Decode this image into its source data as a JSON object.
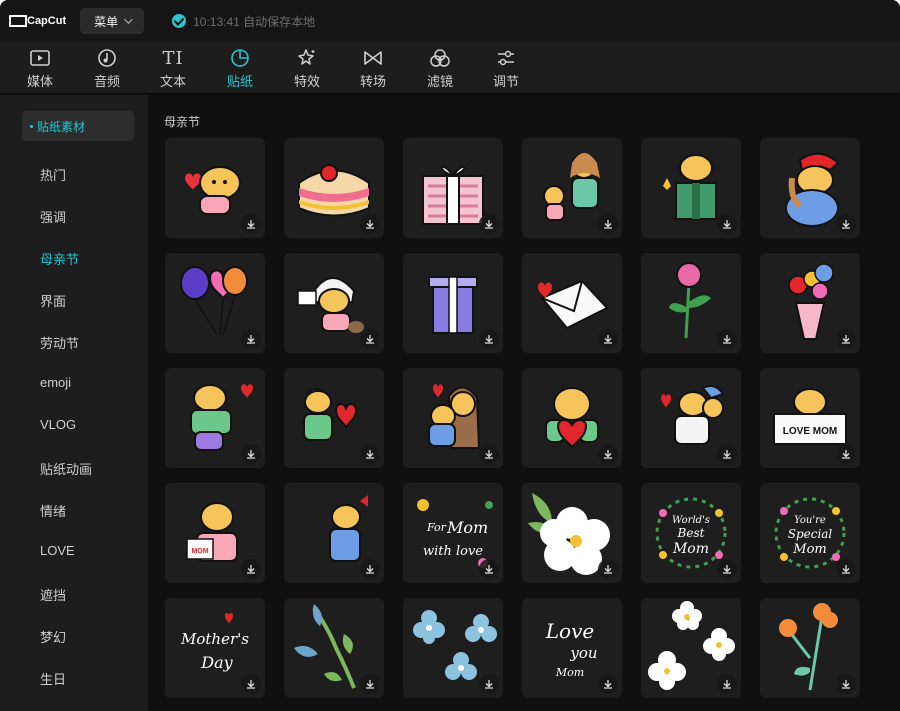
{
  "app": {
    "logo_text": "CapCut",
    "menu_label": "菜单",
    "save_status": "10:13:41 自动保存本地"
  },
  "toolbar": {
    "items": [
      {
        "label": "媒体",
        "icon": "media-icon",
        "active": false
      },
      {
        "label": "音频",
        "icon": "audio-icon",
        "active": false
      },
      {
        "label": "文本",
        "icon": "text-icon",
        "active": false
      },
      {
        "label": "贴纸",
        "icon": "sticker-icon",
        "active": true
      },
      {
        "label": "特效",
        "icon": "effects-icon",
        "active": false
      },
      {
        "label": "转场",
        "icon": "transition-icon",
        "active": false
      },
      {
        "label": "滤镜",
        "icon": "filter-icon",
        "active": false
      },
      {
        "label": "调节",
        "icon": "adjust-icon",
        "active": false
      }
    ],
    "text_icon_glyph": "TI"
  },
  "sidebar": {
    "header": "贴纸素材",
    "items": [
      {
        "label": "热门"
      },
      {
        "label": "强调"
      },
      {
        "label": "母亲节",
        "active": true
      },
      {
        "label": "界面"
      },
      {
        "label": "劳动节"
      },
      {
        "label": "emoji"
      },
      {
        "label": "VLOG"
      },
      {
        "label": "贴纸动画"
      },
      {
        "label": "情绪"
      },
      {
        "label": "LOVE"
      },
      {
        "label": "遮挡"
      },
      {
        "label": "梦幻"
      },
      {
        "label": "生日"
      }
    ]
  },
  "content": {
    "section_title": "母亲节",
    "stickers": [
      {
        "name": "cartoon-heart-character"
      },
      {
        "name": "cake"
      },
      {
        "name": "gift-box-pink"
      },
      {
        "name": "mother-and-child"
      },
      {
        "name": "character-with-gift"
      },
      {
        "name": "character-red-hat"
      },
      {
        "name": "heart-balloons"
      },
      {
        "name": "character-with-card"
      },
      {
        "name": "gift-box-purple"
      },
      {
        "name": "envelope-heart"
      },
      {
        "name": "flower-pink"
      },
      {
        "name": "flower-bouquet"
      },
      {
        "name": "hug-character"
      },
      {
        "name": "character-holding-heart"
      },
      {
        "name": "couple-hugging"
      },
      {
        "name": "character-with-heart"
      },
      {
        "name": "hugging-pair"
      },
      {
        "name": "love-mom-sign"
      },
      {
        "name": "character-with-mom-card"
      },
      {
        "name": "character-with-bow"
      },
      {
        "name": "for-mom-with-love-text",
        "text": "For Mom with love"
      },
      {
        "name": "white-flower"
      },
      {
        "name": "worlds-best-mom-text",
        "text": "World's Best Mom"
      },
      {
        "name": "youre-special-mom-text",
        "text": "You're Special Mom"
      },
      {
        "name": "mothers-day-text",
        "text": "Mother's Day"
      },
      {
        "name": "blue-flower-stem"
      },
      {
        "name": "blue-flowers"
      },
      {
        "name": "love-you-mom-text",
        "text": "Love you Mom"
      },
      {
        "name": "white-flowers"
      },
      {
        "name": "orange-flowers"
      }
    ],
    "sticker_texts": {
      "love_mom": "LOVE MOM",
      "mom": "MOM",
      "for": "For",
      "mom_script": "Mom",
      "with_love": "with love",
      "worlds": "World's",
      "best": "Best",
      "mom2": "Mom",
      "youre": "You're",
      "special": "Special",
      "mom3": "Mom",
      "mothers": "Mother's",
      "day": "Day",
      "love": "Love",
      "you": "you",
      "mom4": "Mom"
    }
  },
  "colors": {
    "accent": "#23c4d2",
    "bg": "#101010",
    "panel": "#1d1d1d",
    "tile": "#1e1e1e"
  }
}
